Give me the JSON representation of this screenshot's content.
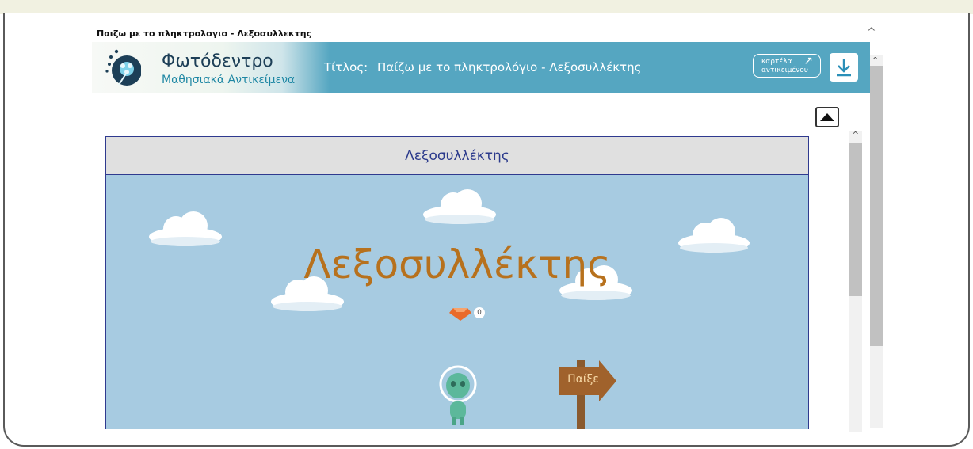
{
  "window": {
    "page_title": "Παιζω με το πληκτρολογιο - Λεξοσυλλεκτης"
  },
  "header": {
    "brand_name": "Φωτόδεντρο",
    "brand_sub": "Μαθησιακά Αντικείμενα",
    "title_label": "Τίτλος:",
    "title_value": "Παίζω με το πληκτρολόγιο - Λεξοσυλλέκτης",
    "card_button_line1": "καρτέλα",
    "card_button_line2": "αντικειμένου",
    "card_button_arrow": "↗",
    "colors": {
      "bar": "#55a6c1",
      "brand": "#1d3f57",
      "sub": "#1e87a4"
    }
  },
  "game": {
    "header_title": "Λεξοσυλλέκτης",
    "title": "Λεξοσυλλέκτης",
    "gem_count": "0",
    "play_sign": "Παίξε",
    "colors": {
      "sky": "#a7cbe1",
      "title": "#b7711d",
      "ground": "#7ac142"
    }
  },
  "icons": {
    "download": "download-icon",
    "collapse": "triangle-up-icon",
    "logo": "dandelion-logo-icon",
    "gem": "gem-icon"
  }
}
